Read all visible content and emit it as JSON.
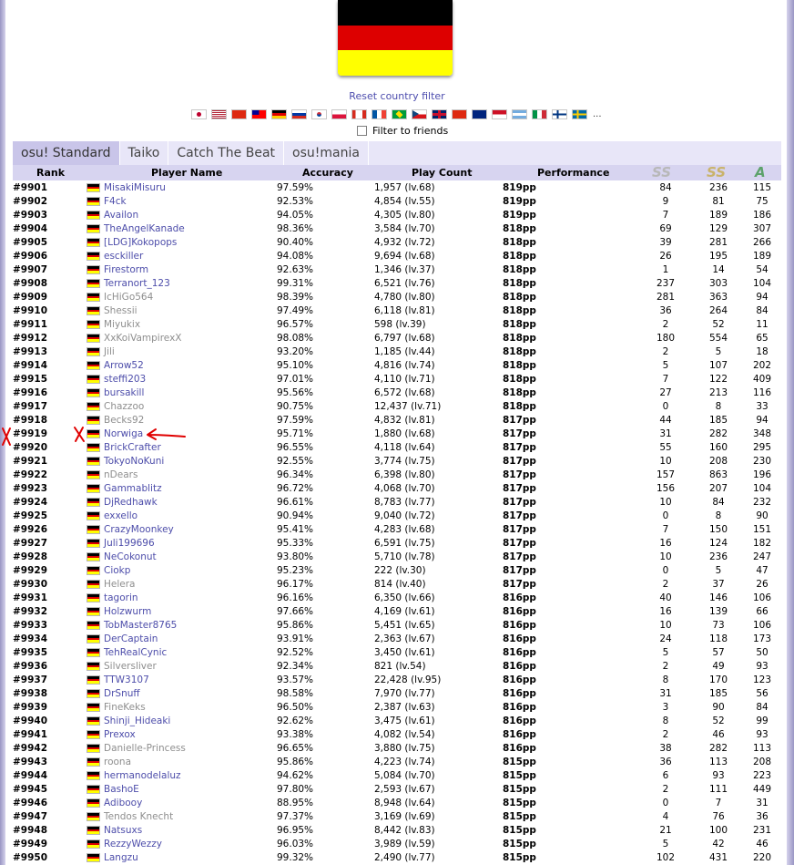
{
  "country": {
    "name": "Germany",
    "flag_colors": [
      "#000000",
      "#dd0000",
      "#ffff00"
    ]
  },
  "reset_filter_label": "Reset country filter",
  "flags": [
    {
      "icon": "japan-flag-icon"
    },
    {
      "icon": "usa-flag-icon"
    },
    {
      "icon": "china-flag-icon"
    },
    {
      "icon": "taiwan-flag-icon"
    },
    {
      "icon": "germany-flag-icon"
    },
    {
      "icon": "russia-flag-icon"
    },
    {
      "icon": "south-korea-flag-icon"
    },
    {
      "icon": "poland-flag-icon"
    },
    {
      "icon": "canada-flag-icon"
    },
    {
      "icon": "france-flag-icon"
    },
    {
      "icon": "brazil-flag-icon"
    },
    {
      "icon": "czech-flag-icon"
    },
    {
      "icon": "uk-flag-icon"
    },
    {
      "icon": "hong-kong-flag-icon"
    },
    {
      "icon": "australia-flag-icon"
    },
    {
      "icon": "indonesia-flag-icon"
    },
    {
      "icon": "argentina-flag-icon"
    },
    {
      "icon": "italy-flag-icon"
    },
    {
      "icon": "finland-flag-icon"
    },
    {
      "icon": "sweden-flag-icon"
    }
  ],
  "more_flags": "...",
  "friends_filter_label": "Filter to friends",
  "tabs": [
    {
      "label": "osu! Standard",
      "active": true
    },
    {
      "label": "Taiko",
      "active": false
    },
    {
      "label": "Catch The Beat",
      "active": false
    },
    {
      "label": "osu!mania",
      "active": false
    }
  ],
  "columns": {
    "rank": "Rank",
    "player": "Player Name",
    "accuracy": "Accuracy",
    "playcount": "Play Count",
    "performance": "Performance",
    "grade_ss_silver": "SS",
    "grade_ss": "SS",
    "grade_a": "A"
  },
  "grade_colors": {
    "ss_silver": "#b8b8b8",
    "ss": "#c9b36b",
    "a": "#5da26b"
  },
  "rows": [
    [
      "#9901",
      "MisakiMisuru",
      "97.59%",
      "1,957 (lv.68)",
      "819pp",
      "84",
      "236",
      "115",
      false
    ],
    [
      "#9902",
      "F4ck",
      "92.53%",
      "4,854 (lv.55)",
      "819pp",
      "9",
      "81",
      "75",
      false
    ],
    [
      "#9903",
      "Availon",
      "94.05%",
      "4,305 (lv.80)",
      "819pp",
      "7",
      "189",
      "186",
      false
    ],
    [
      "#9904",
      "TheAngelKanade",
      "98.36%",
      "3,584 (lv.70)",
      "818pp",
      "69",
      "129",
      "307",
      false
    ],
    [
      "#9905",
      "[LDG]Kokopops",
      "90.40%",
      "4,932 (lv.72)",
      "818pp",
      "39",
      "281",
      "266",
      false
    ],
    [
      "#9906",
      "esckiller",
      "94.08%",
      "9,694 (lv.68)",
      "818pp",
      "26",
      "195",
      "189",
      false
    ],
    [
      "#9907",
      "Firestorm",
      "92.63%",
      "1,346 (lv.37)",
      "818pp",
      "1",
      "14",
      "54",
      false
    ],
    [
      "#9908",
      "Terranort_123",
      "99.31%",
      "6,521 (lv.76)",
      "818pp",
      "237",
      "303",
      "104",
      false
    ],
    [
      "#9909",
      "IcHiGo564",
      "98.39%",
      "4,780 (lv.80)",
      "818pp",
      "281",
      "363",
      "94",
      true
    ],
    [
      "#9910",
      "Shessii",
      "97.49%",
      "6,118 (lv.81)",
      "818pp",
      "36",
      "264",
      "84",
      true
    ],
    [
      "#9911",
      "Miyukix",
      "96.57%",
      "598 (lv.39)",
      "818pp",
      "2",
      "52",
      "11",
      true
    ],
    [
      "#9912",
      "XxKoiVampirexX",
      "98.08%",
      "6,797 (lv.68)",
      "818pp",
      "180",
      "554",
      "65",
      true
    ],
    [
      "#9913",
      "Jili",
      "93.20%",
      "1,185 (lv.44)",
      "818pp",
      "2",
      "5",
      "18",
      true
    ],
    [
      "#9914",
      "Arrow52",
      "95.10%",
      "4,816 (lv.74)",
      "818pp",
      "5",
      "107",
      "202",
      false
    ],
    [
      "#9915",
      "steffi203",
      "97.01%",
      "4,110 (lv.71)",
      "818pp",
      "7",
      "122",
      "409",
      false
    ],
    [
      "#9916",
      "bursakill",
      "95.56%",
      "6,572 (lv.68)",
      "818pp",
      "27",
      "213",
      "116",
      false
    ],
    [
      "#9917",
      "Chazzoo",
      "90.75%",
      "12,437 (lv.71)",
      "818pp",
      "0",
      "8",
      "33",
      true
    ],
    [
      "#9918",
      "Becks92",
      "97.59%",
      "4,832 (lv.81)",
      "817pp",
      "44",
      "185",
      "94",
      true
    ],
    [
      "#9919",
      "Norwiga",
      "95.71%",
      "1,880 (lv.68)",
      "817pp",
      "31",
      "282",
      "348",
      false
    ],
    [
      "#9920",
      "BrickCrafter",
      "96.55%",
      "4,118 (lv.64)",
      "817pp",
      "55",
      "160",
      "295",
      false
    ],
    [
      "#9921",
      "TokyoNoKuni",
      "92.55%",
      "3,774 (lv.75)",
      "817pp",
      "10",
      "208",
      "230",
      false
    ],
    [
      "#9922",
      "nDears",
      "96.34%",
      "6,398 (lv.80)",
      "817pp",
      "157",
      "863",
      "196",
      true
    ],
    [
      "#9923",
      "Gammablitz",
      "96.72%",
      "4,068 (lv.70)",
      "817pp",
      "156",
      "207",
      "104",
      false
    ],
    [
      "#9924",
      "DjRedhawk",
      "96.61%",
      "8,783 (lv.77)",
      "817pp",
      "10",
      "84",
      "232",
      false
    ],
    [
      "#9925",
      "exxello",
      "90.94%",
      "9,040 (lv.72)",
      "817pp",
      "0",
      "8",
      "90",
      false
    ],
    [
      "#9926",
      "CrazyMoonkey",
      "95.41%",
      "4,283 (lv.68)",
      "817pp",
      "7",
      "150",
      "151",
      false
    ],
    [
      "#9927",
      "Juli199696",
      "95.33%",
      "6,591 (lv.75)",
      "817pp",
      "16",
      "124",
      "182",
      false
    ],
    [
      "#9928",
      "NeCokonut",
      "93.80%",
      "5,710 (lv.78)",
      "817pp",
      "10",
      "236",
      "247",
      false
    ],
    [
      "#9929",
      "Ciokp",
      "95.23%",
      "222 (lv.30)",
      "817pp",
      "0",
      "5",
      "47",
      false
    ],
    [
      "#9930",
      "Helera",
      "96.17%",
      "814 (lv.40)",
      "817pp",
      "2",
      "37",
      "26",
      true
    ],
    [
      "#9931",
      "tagorin",
      "96.16%",
      "6,350 (lv.66)",
      "816pp",
      "40",
      "146",
      "106",
      false
    ],
    [
      "#9932",
      "Holzwurm",
      "97.66%",
      "4,169 (lv.61)",
      "816pp",
      "16",
      "139",
      "66",
      false
    ],
    [
      "#9933",
      "TobMaster8765",
      "95.86%",
      "5,451 (lv.65)",
      "816pp",
      "10",
      "73",
      "106",
      false
    ],
    [
      "#9934",
      "DerCaptain",
      "93.91%",
      "2,363 (lv.67)",
      "816pp",
      "24",
      "118",
      "173",
      false
    ],
    [
      "#9935",
      "TehRealCynic",
      "92.52%",
      "3,450 (lv.61)",
      "816pp",
      "5",
      "57",
      "50",
      false
    ],
    [
      "#9936",
      "Silversliver",
      "92.34%",
      "821 (lv.54)",
      "816pp",
      "2",
      "49",
      "93",
      true
    ],
    [
      "#9937",
      "TTW3107",
      "93.57%",
      "22,428 (lv.95)",
      "816pp",
      "8",
      "170",
      "123",
      false
    ],
    [
      "#9938",
      "DrSnuff",
      "98.58%",
      "7,970 (lv.77)",
      "816pp",
      "31",
      "185",
      "56",
      false
    ],
    [
      "#9939",
      "FineKeks",
      "96.50%",
      "2,387 (lv.63)",
      "816pp",
      "3",
      "90",
      "84",
      true
    ],
    [
      "#9940",
      "Shinji_Hideaki",
      "92.62%",
      "3,475 (lv.61)",
      "816pp",
      "8",
      "52",
      "99",
      false
    ],
    [
      "#9941",
      "Prexox",
      "93.38%",
      "4,082 (lv.54)",
      "816pp",
      "2",
      "46",
      "93",
      false
    ],
    [
      "#9942",
      "Danielle-Princess",
      "96.65%",
      "3,880 (lv.75)",
      "816pp",
      "38",
      "282",
      "113",
      true
    ],
    [
      "#9943",
      "roona",
      "95.86%",
      "4,223 (lv.74)",
      "815pp",
      "36",
      "113",
      "208",
      true
    ],
    [
      "#9944",
      "hermanodelaluz",
      "94.62%",
      "5,084 (lv.70)",
      "815pp",
      "6",
      "93",
      "223",
      false
    ],
    [
      "#9945",
      "BashoE",
      "97.80%",
      "2,593 (lv.67)",
      "815pp",
      "2",
      "111",
      "449",
      false
    ],
    [
      "#9946",
      "Adibooy",
      "88.95%",
      "8,948 (lv.64)",
      "815pp",
      "0",
      "7",
      "31",
      false
    ],
    [
      "#9947",
      "Tendos Knecht",
      "97.37%",
      "3,169 (lv.69)",
      "815pp",
      "4",
      "76",
      "36",
      true
    ],
    [
      "#9948",
      "Natsuxs",
      "96.95%",
      "8,442 (lv.83)",
      "815pp",
      "21",
      "100",
      "231",
      false
    ],
    [
      "#9949",
      "RezzyWezzy",
      "96.03%",
      "3,989 (lv.59)",
      "815pp",
      "5",
      "42",
      "46",
      false
    ],
    [
      "#9950",
      "Langzu",
      "99.32%",
      "2,490 (lv.77)",
      "815pp",
      "102",
      "431",
      "220",
      false
    ]
  ],
  "annotation": {
    "color": "#e00000",
    "marks": [
      "x-mark",
      "x-mark",
      "arrow"
    ]
  }
}
